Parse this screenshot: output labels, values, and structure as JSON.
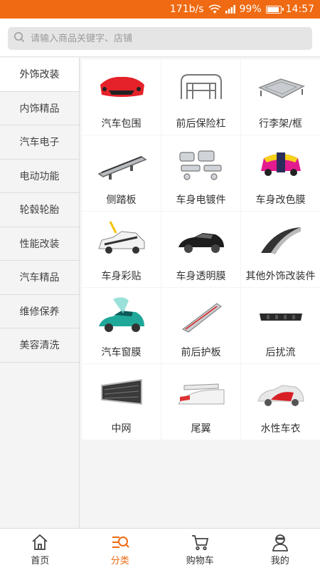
{
  "status_bar": {
    "speed": "171b/s",
    "battery": "99%",
    "battery_level": 0.99,
    "time": "14:57",
    "bg_color": "#ef6a12"
  },
  "search": {
    "placeholder": "请输入商品关键字、店铺"
  },
  "sidebar": {
    "items": [
      {
        "label": "外饰改装"
      },
      {
        "label": "内饰精品"
      },
      {
        "label": "汽车电子"
      },
      {
        "label": "电动功能"
      },
      {
        "label": "轮毂轮胎"
      },
      {
        "label": "性能改装"
      },
      {
        "label": "汽车精品"
      },
      {
        "label": "维修保养"
      },
      {
        "label": "美容清洗"
      }
    ],
    "active_index": 0
  },
  "products": [
    {
      "label": "汽车包围",
      "icon": "red-bumper-icon"
    },
    {
      "label": "前后保险杠",
      "icon": "bull-bar-icon"
    },
    {
      "label": "行李架/框",
      "icon": "roof-rack-icon"
    },
    {
      "label": "侧踏板",
      "icon": "side-step-icon"
    },
    {
      "label": "车身电镀件",
      "icon": "chrome-parts-icon"
    },
    {
      "label": "车身改色膜",
      "icon": "color-wrap-car-icon"
    },
    {
      "label": "车身彩贴",
      "icon": "car-decal-icon"
    },
    {
      "label": "车身透明膜",
      "icon": "black-sportscar-icon"
    },
    {
      "label": "其他外饰改装件",
      "icon": "trim-strip-icon"
    },
    {
      "label": "汽车窗膜",
      "icon": "window-film-car-icon"
    },
    {
      "label": "前后护板",
      "icon": "guard-plate-icon"
    },
    {
      "label": "后扰流",
      "icon": "rear-diffuser-icon"
    },
    {
      "label": "中网",
      "icon": "front-grille-icon"
    },
    {
      "label": "尾翼",
      "icon": "rear-wing-icon"
    },
    {
      "label": "水性车衣",
      "icon": "car-cover-icon"
    }
  ],
  "bottom_nav": {
    "items": [
      {
        "label": "首页",
        "icon": "home-icon"
      },
      {
        "label": "分类",
        "icon": "category-icon"
      },
      {
        "label": "购物车",
        "icon": "cart-icon"
      },
      {
        "label": "我的",
        "icon": "profile-icon"
      }
    ],
    "active_index": 1,
    "accent_color": "#ef6a12"
  }
}
